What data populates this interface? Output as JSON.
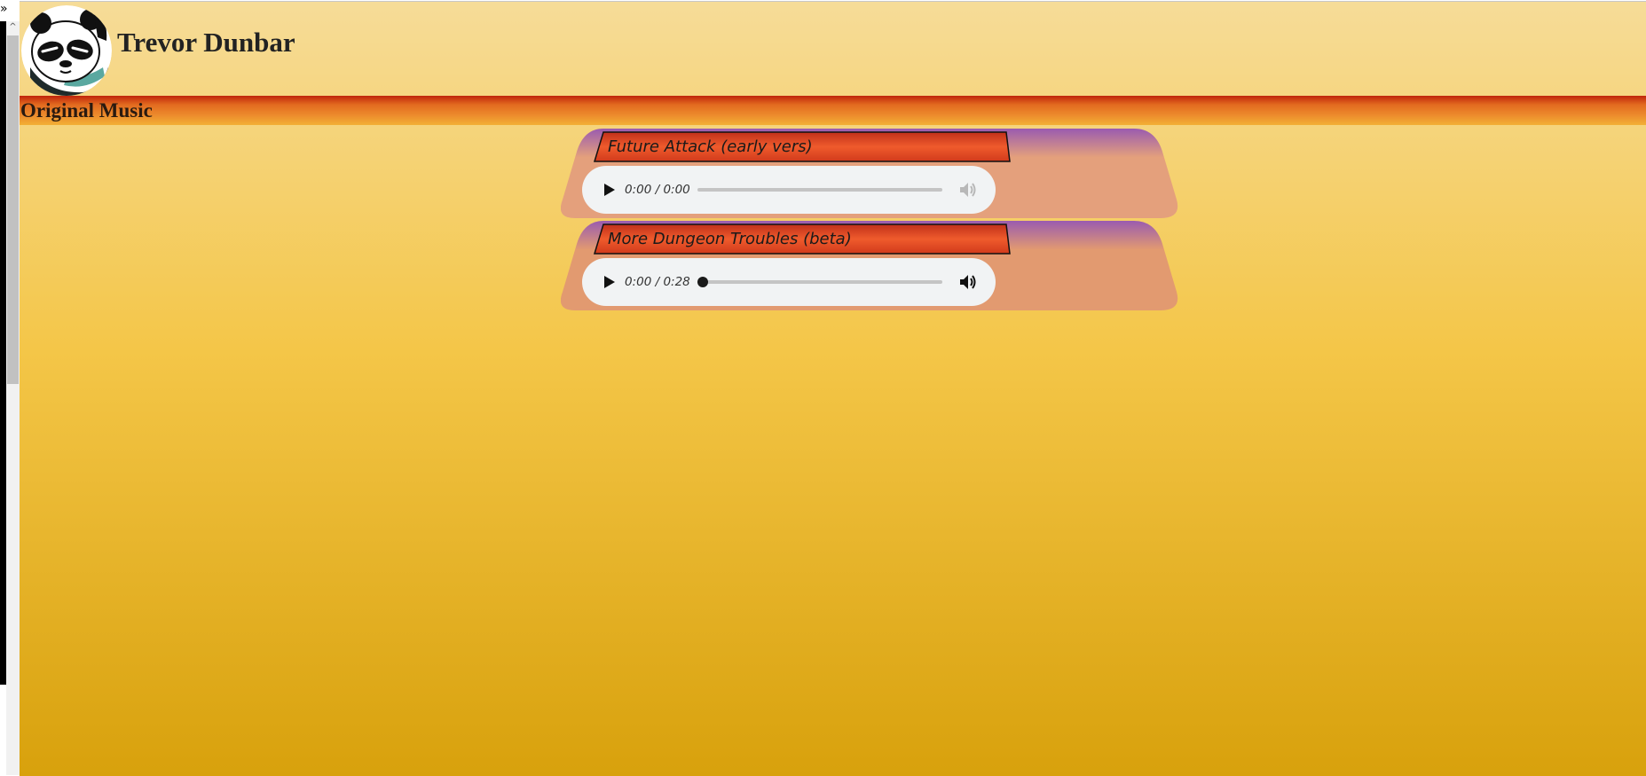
{
  "site": {
    "title": "Trevor Dunbar",
    "avatar_icon": "panda-avatar-icon"
  },
  "section": {
    "title": "Original Music"
  },
  "tracks": [
    {
      "title": "Future Attack (early vers)",
      "time": "0:00 / 0:00",
      "progress": 0,
      "volume_enabled": false
    },
    {
      "title": "More Dungeon Troubles (beta)",
      "time": "0:00 / 0:28",
      "progress": 0,
      "volume_enabled": true
    }
  ],
  "chrome": {
    "collapse_glyph": "»",
    "scroll_up_glyph": "^"
  },
  "colors": {
    "header_bg": "#f6dc98",
    "page_bottom": "#d8a10c",
    "section_bar": "#e26a1f",
    "card_bg": "#e4a07c",
    "card_top": "#9a5bb0",
    "title_band": "#e8542a"
  }
}
